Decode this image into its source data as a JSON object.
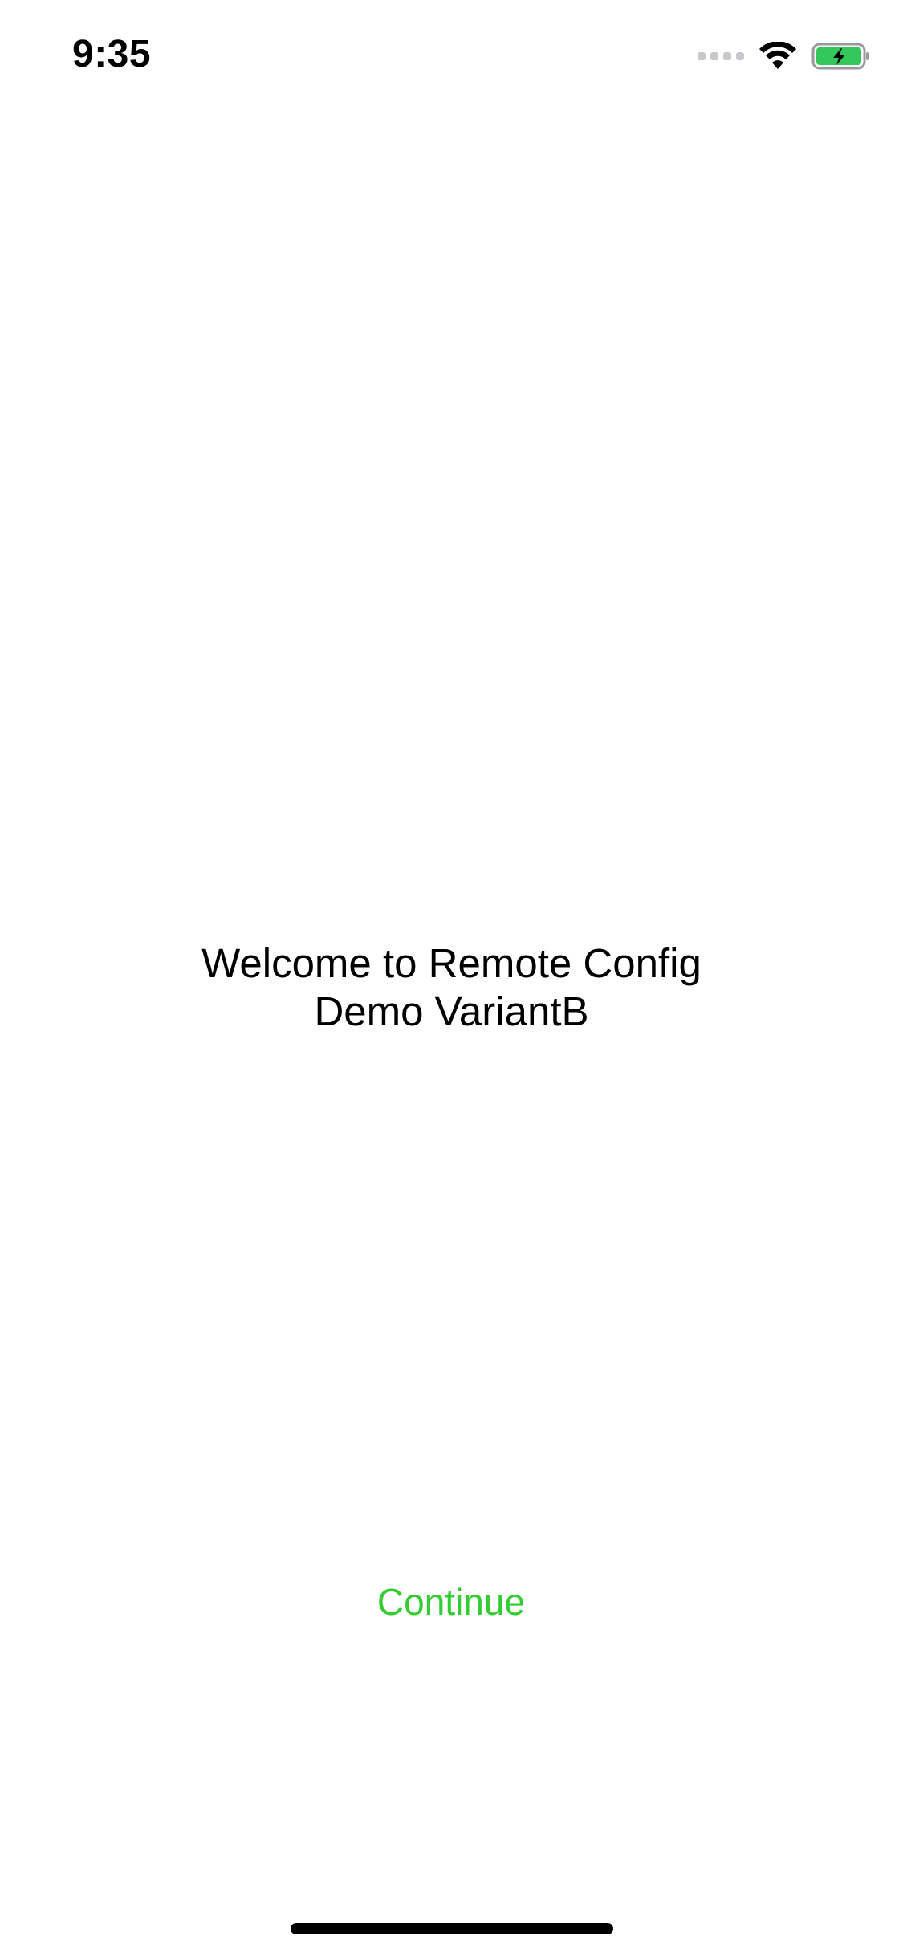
{
  "status_bar": {
    "time": "9:35",
    "icons": [
      "cellular-signal-icon",
      "wifi-icon",
      "battery-charging-icon"
    ],
    "battery_color": "#34c759"
  },
  "main": {
    "welcome_text": "Welcome to Remote Config\nDemo VariantB"
  },
  "actions": {
    "continue_label": "Continue",
    "continue_color": "#33cc33"
  }
}
